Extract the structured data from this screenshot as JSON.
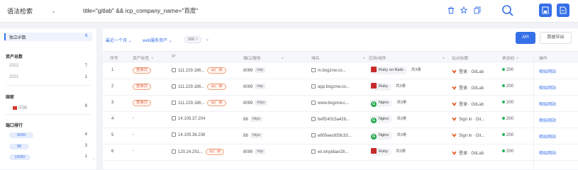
{
  "header": {
    "syntax_label": "语法检索",
    "query": "title=\"gitlab\" && icp_company_name=\"百度\""
  },
  "sidebar": {
    "independent_ip": {
      "label": "独立IP数",
      "count": "6"
    },
    "asset_year": {
      "title": "资产总数",
      "items": [
        {
          "label": "2022",
          "count": "7"
        },
        {
          "label": "2021",
          "count": "1"
        }
      ]
    },
    "country": {
      "title": "国家",
      "items": [
        {
          "label": "中国",
          "count": "8"
        }
      ]
    },
    "port_rank": {
      "title": "端口排行",
      "items": [
        {
          "label": "8099",
          "count": "4"
        },
        {
          "label": "88",
          "count": "3"
        },
        {
          "label": "10080",
          "count": "1"
        }
      ]
    }
  },
  "toolbar": {
    "time_filter": "最近一个月",
    "web_filter": "web服务资产",
    "status_tag": "200",
    "api_label": "API",
    "export_label": "数据导出"
  },
  "table": {
    "headers": [
      "序号",
      "资产标签",
      "IP",
      "端口/服务",
      "域名",
      "应用/组件",
      "站点标题",
      "状态码",
      "操作"
    ],
    "rows": [
      {
        "idx": "1",
        "tag": "登录页",
        "ip": "111.229.186...",
        "cloud": "云厂商",
        "port": "8099",
        "svc": "http",
        "domain": "m.bxgznw.co...",
        "app": "Ruby on Rails",
        "app_color": "#c82b2b",
        "total": "共3条",
        "title": "登录 · GitLab",
        "status": "200",
        "op": "相似网站"
      },
      {
        "idx": "2",
        "tag": "登录页",
        "ip": "111.229.186...",
        "cloud": "云厂商",
        "port": "8099",
        "svc": "http",
        "domain": "app.bxgznw.co...",
        "app": "Ruby",
        "app_color": "#c82b2b",
        "total": "共3条",
        "title": "登录 · GitLab",
        "status": "200",
        "op": "相似网站"
      },
      {
        "idx": "3",
        "tag": "登录页",
        "ip": "111.229.186...",
        "cloud": "云厂商",
        "port": "8099",
        "svc": "https",
        "domain": "www.bxgznw.c...",
        "app": "Nginx",
        "app_color": "#22a74b",
        "total": "共3条",
        "title": "登录 · GitLab",
        "status": "200",
        "op": "相似网站"
      },
      {
        "idx": "4",
        "tag": "-",
        "ip": "14.105.37.204",
        "cloud": "",
        "port": "88",
        "svc": "https",
        "domain": "beff24015a42b...",
        "app": "Nginx",
        "app_color": "#22a74b",
        "total": "共3条",
        "title": "Sign in · Git...",
        "status": "200",
        "op": "相似网站"
      },
      {
        "idx": "5",
        "tag": "-",
        "ip": "14.105.36.236",
        "cloud": "",
        "port": "88",
        "svc": "https",
        "domain": "e805eec659c33...",
        "app": "Nginx",
        "app_color": "#22a74b",
        "total": "共3条",
        "title": "Sign in · Git...",
        "status": "200",
        "op": "相似网站"
      },
      {
        "idx": "6",
        "tag": "-",
        "ip": "120.24.251...",
        "cloud": "云厂商",
        "port": "8099",
        "svc": "http",
        "domain": "wt.xinpidian28...",
        "app": "Ruby",
        "app_color": "#c82b2b",
        "total": "共3条",
        "title": "登录 · GitLab",
        "status": "200",
        "op": "相似网站"
      }
    ]
  },
  "colors": {
    "accent": "#3670e8",
    "tag_orange": "#e4664a",
    "status_green": "#21b45a"
  },
  "icons": [
    "chevron-down-icon",
    "trash-icon",
    "star-icon",
    "copy-icon",
    "search-icon",
    "save-icon",
    "download-icon",
    "filter-icon",
    "external-link-icon",
    "gitlab-icon"
  ]
}
